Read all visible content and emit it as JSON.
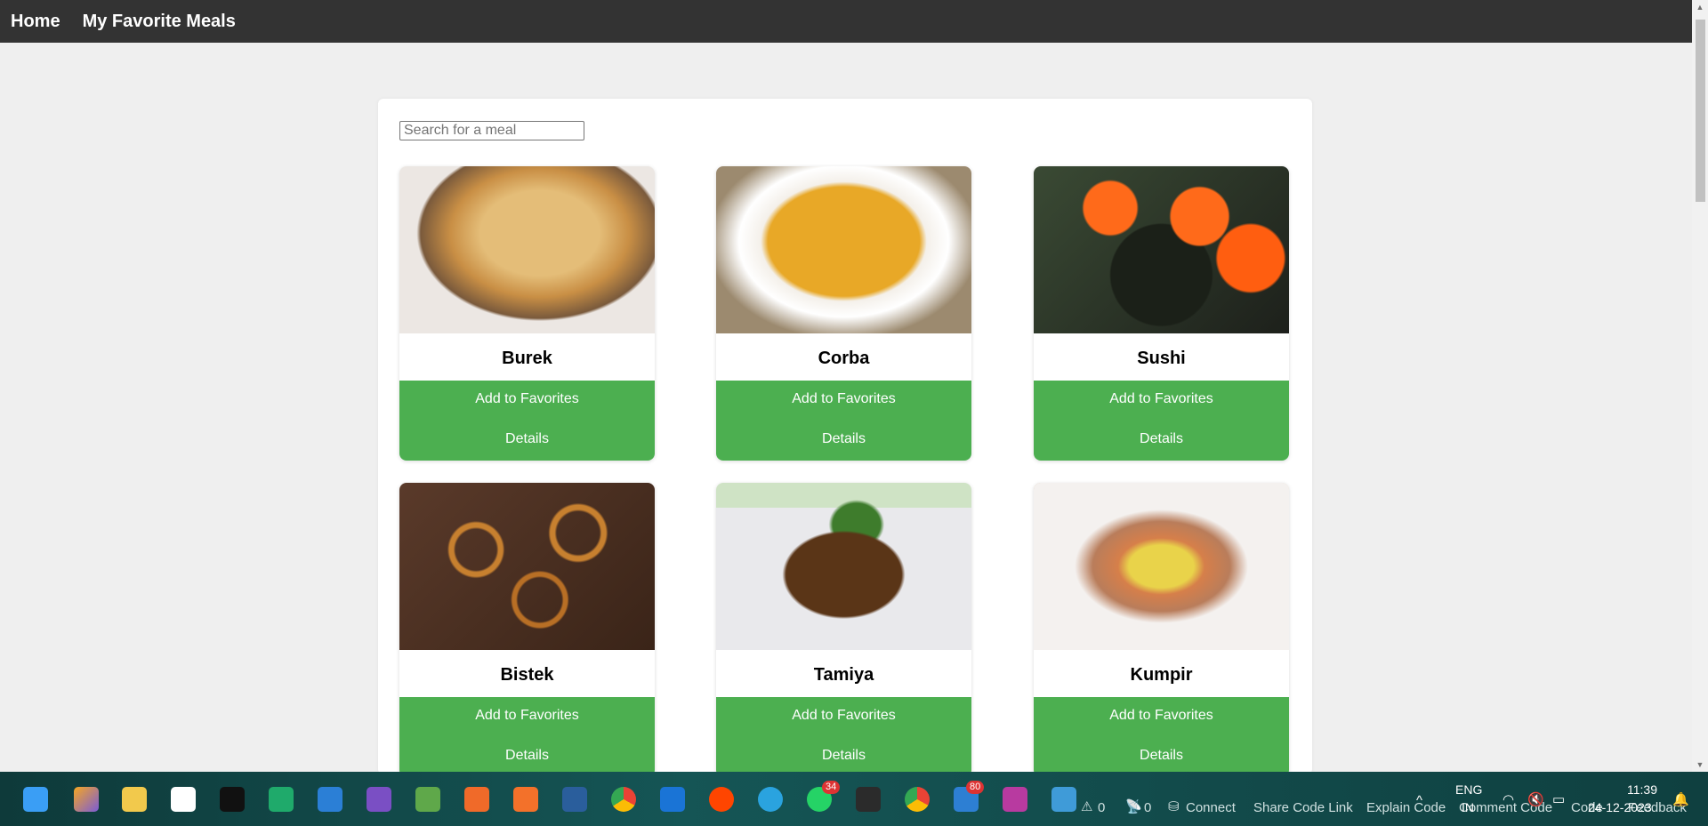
{
  "nav": {
    "home": "Home",
    "favorites": "My Favorite Meals"
  },
  "search": {
    "placeholder": "Search for a meal",
    "value": ""
  },
  "meals": [
    {
      "name": "Burek",
      "favorite_label": "Add to Favorites",
      "details_label": "Details"
    },
    {
      "name": "Corba",
      "favorite_label": "Add to Favorites",
      "details_label": "Details"
    },
    {
      "name": "Sushi",
      "favorite_label": "Add to Favorites",
      "details_label": "Details"
    },
    {
      "name": "Bistek",
      "favorite_label": "Add to Favorites",
      "details_label": "Details"
    },
    {
      "name": "Tamiya",
      "favorite_label": "Add to Favorites",
      "details_label": "Details"
    },
    {
      "name": "Kumpir",
      "favorite_label": "Add to Favorites",
      "details_label": "Details"
    }
  ],
  "colors": {
    "nav_bg": "#333333",
    "button_green": "#4caf50",
    "page_bg": "#efefef"
  },
  "taskbar": {
    "badges": [
      "34",
      "80"
    ],
    "status_items": [
      "0",
      "0",
      "Connect",
      "Share Code Link",
      "Explain Code",
      "Comment Code",
      "Code",
      "Feedback"
    ],
    "language": "ENG",
    "region": "IN",
    "time": "11:39",
    "date": "24-12-2023"
  }
}
